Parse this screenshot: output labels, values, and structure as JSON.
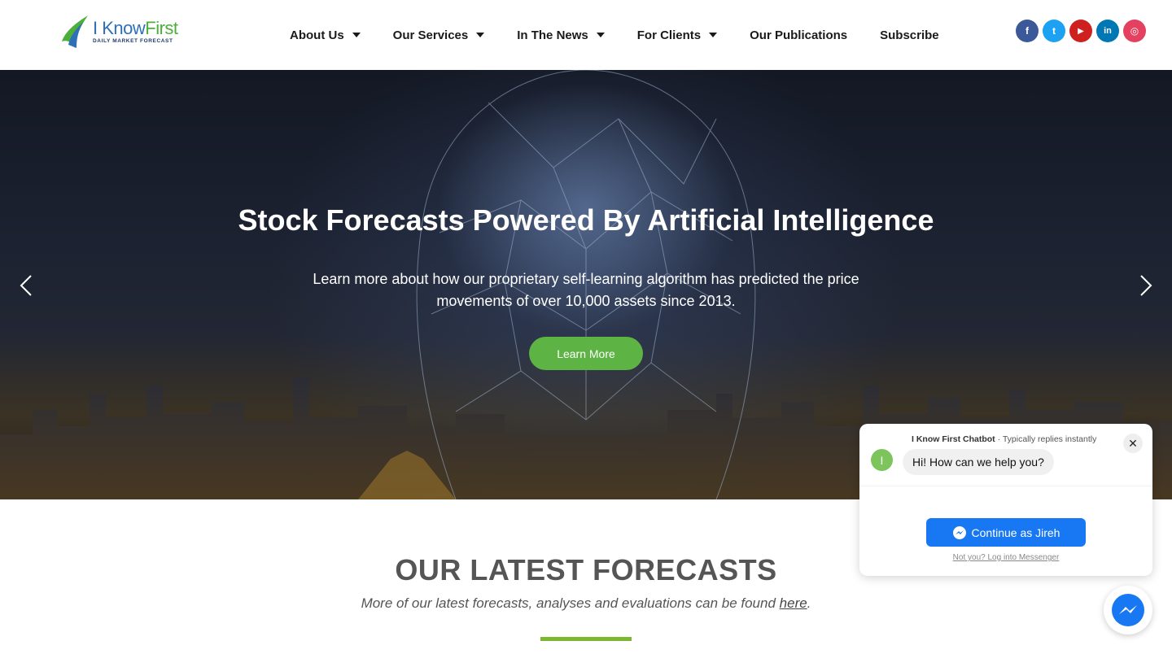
{
  "logo": {
    "title_a": "I Know",
    "title_b": "First",
    "subtitle": "DAILY MARKET FORECAST"
  },
  "nav": {
    "items": [
      {
        "label": "About Us",
        "dropdown": true
      },
      {
        "label": "Our Services",
        "dropdown": true
      },
      {
        "label": "In The News",
        "dropdown": true
      },
      {
        "label": "For Clients",
        "dropdown": true
      },
      {
        "label": "Our Publications",
        "dropdown": false
      },
      {
        "label": "Subscribe",
        "dropdown": false
      }
    ]
  },
  "social": [
    {
      "name": "facebook-icon",
      "color": "#3b5998",
      "glyph": "f"
    },
    {
      "name": "twitter-icon",
      "color": "#1da1f2",
      "glyph": "t"
    },
    {
      "name": "youtube-icon",
      "color": "#cd201f",
      "glyph": "▶"
    },
    {
      "name": "linkedin-icon",
      "color": "#0077b5",
      "glyph": "in"
    },
    {
      "name": "instagram-icon",
      "color": "#e4405f",
      "glyph": "◎"
    }
  ],
  "hero": {
    "title": "Stock Forecasts Powered By Artificial Intelligence",
    "subtitle": "Learn more about how our proprietary self-learning algorithm has predicted the price movements of over 10,000 assets since 2013.",
    "button": "Learn More"
  },
  "forecasts": {
    "title": "OUR LATEST FORECASTS",
    "subtitle_pre": "More of our latest forecasts, analyses and evaluations can be found ",
    "subtitle_link": "here",
    "subtitle_post": "."
  },
  "chat": {
    "bot_name": "I Know First Chatbot",
    "status": " · Typically replies instantly",
    "avatar_letter": "I",
    "message": "Hi! How can we help you?",
    "continue_button": "Continue as Jireh",
    "alt_link": "Not you? Log into Messenger",
    "close": "✕"
  },
  "colors": {
    "accent_green": "#5db343",
    "messenger_blue": "#1877f2"
  }
}
